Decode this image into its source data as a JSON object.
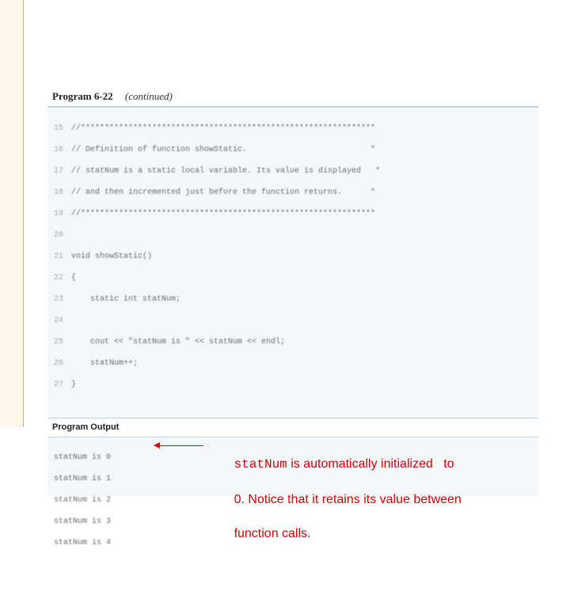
{
  "header": {
    "program_label": "Program 6-22",
    "continued": "(continued)"
  },
  "code": [
    {
      "n": "15",
      "t": "//**************************************************************"
    },
    {
      "n": "16",
      "t": "// Definition of function showStatic.                          *"
    },
    {
      "n": "17",
      "t": "// statNum is a static local variable. Its value is displayed   *"
    },
    {
      "n": "18",
      "t": "// and then incremented just before the function returns.      *"
    },
    {
      "n": "19",
      "t": "//**************************************************************"
    },
    {
      "n": "20",
      "t": ""
    },
    {
      "n": "21",
      "t": "void showStatic()"
    },
    {
      "n": "22",
      "t": "{"
    },
    {
      "n": "23",
      "t": "    static int statNum;"
    },
    {
      "n": "24",
      "t": ""
    },
    {
      "n": "25",
      "t": "    cout << \"statNum is \" << statNum << endl;"
    },
    {
      "n": "26",
      "t": "    statNum++;"
    },
    {
      "n": "27",
      "t": "}"
    }
  ],
  "output_header": "Program Output",
  "output": [
    "statNum is 0",
    "statNum is 1",
    "statNum is 2",
    "statNum is 3",
    "statNum is 4"
  ],
  "callout": {
    "mono": "statNum",
    "rest1": " is automatically initialized   to",
    "line2": "0. Notice that it retains its value between",
    "line3": "function calls."
  }
}
